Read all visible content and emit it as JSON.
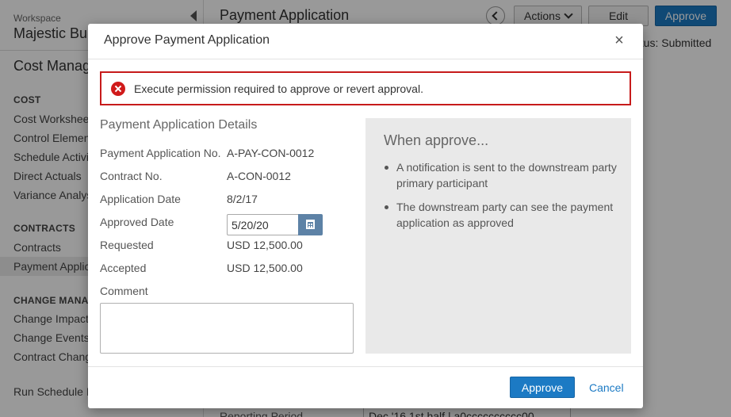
{
  "background": {
    "workspace_label": "Workspace",
    "workspace_name": "Majestic Bu",
    "module_title": "Cost Manag",
    "sections": [
      {
        "header": "COST",
        "items": [
          "Cost Workshee",
          "Control Elemen",
          "Schedule Activi",
          "Direct Actuals",
          "Variance Analys"
        ]
      },
      {
        "header": "CONTRACTS",
        "items": [
          "Contracts",
          "Payment Applic"
        ]
      },
      {
        "header": "CHANGE MANAG",
        "items": [
          "Change Impact",
          "Change Events",
          "Contract Chang"
        ]
      }
    ],
    "run_schedule": "Run Schedule I",
    "page_title": "Payment Application",
    "actions_label": "Actions",
    "edit_label": "Edit",
    "approve_label": "Approve",
    "status_text": "atus: Submitted",
    "bottom_label": "Reporting Period",
    "bottom_value": "Dec '16 1st half | a0cccccccccc00"
  },
  "modal": {
    "title": "Approve Payment Application",
    "close_symbol": "×",
    "error": "Execute permission required to approve or revert approval.",
    "details_title": "Payment Application Details",
    "fields": [
      {
        "label": "Payment Application No.",
        "value": "A-PAY-CON-0012"
      },
      {
        "label": "Contract No.",
        "value": "A-CON-0012"
      },
      {
        "label": "Application Date",
        "value": "8/2/17"
      },
      {
        "label": "Approved Date",
        "value": "5/20/20"
      },
      {
        "label": "Requested",
        "value": "USD 12,500.00"
      },
      {
        "label": "Accepted",
        "value": "USD 12,500.00"
      }
    ],
    "comment_label": "Comment",
    "comment_value": "",
    "info_title": "When approve...",
    "info_items": [
      "A notification is sent to the downstream party primary participant",
      "The downstream party can see the payment application as approved"
    ],
    "approve_button": "Approve",
    "cancel_button": "Cancel"
  },
  "colors": {
    "primary": "#1c7ac4",
    "error": "#c71b1b",
    "calendar_button": "#5d82a6",
    "info_panel": "#e9e9e9"
  }
}
